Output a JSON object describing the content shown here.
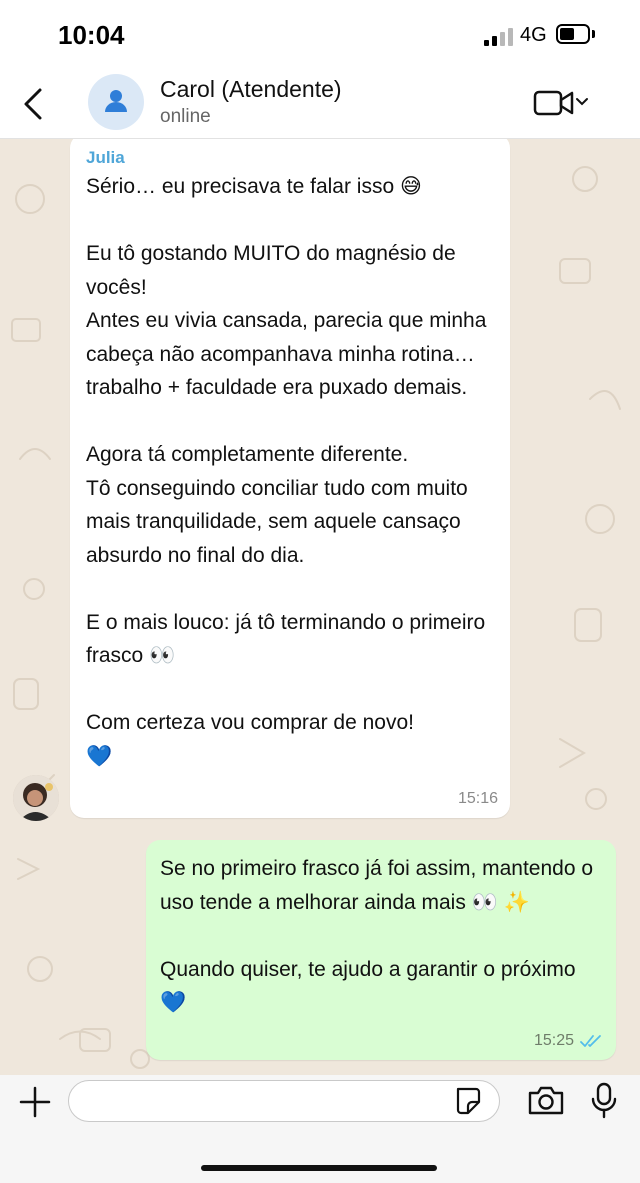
{
  "status_bar": {
    "time": "10:04",
    "network": "4G"
  },
  "header": {
    "contact_name": "Carol (Atendente)",
    "contact_status": "online"
  },
  "messages": [
    {
      "direction": "incoming",
      "sender": "Julia",
      "text": "Sério… eu precisava te falar isso 😅\n\nEu tô gostando MUITO do magnésio de vocês!\nAntes eu vivia cansada, parecia que minha cabeça não acompanhava minha rotina… trabalho + faculdade era puxado demais.\n\nAgora tá completamente diferente.\nTô conseguindo conciliar tudo com muito mais tranquilidade, sem aquele cansaço absurdo no final do dia.\n\nE o mais louco: já tô terminando o primeiro frasco 👀\n\nCom certeza vou comprar de novo!\n💙",
      "time": "15:16"
    },
    {
      "direction": "outgoing",
      "text": "Se no primeiro frasco já foi assim, mantendo o uso tende a melhorar ainda mais 👀 ✨\n\nQuando quiser, te ajudo a garantir o próximo 💙",
      "time": "15:25",
      "read": true
    }
  ],
  "input": {
    "placeholder": ""
  },
  "icons": {
    "back": "chevron-left-icon",
    "video": "video-camera-icon",
    "plus": "plus-icon",
    "sticker": "sticker-icon",
    "camera": "camera-icon",
    "mic": "microphone-icon"
  },
  "colors": {
    "chat_background": "#efe7dc",
    "incoming_bubble": "#ffffff",
    "outgoing_bubble": "#d9fdd3",
    "sender_name": "#4fa6d8",
    "read_ticks": "#53bdeb"
  }
}
